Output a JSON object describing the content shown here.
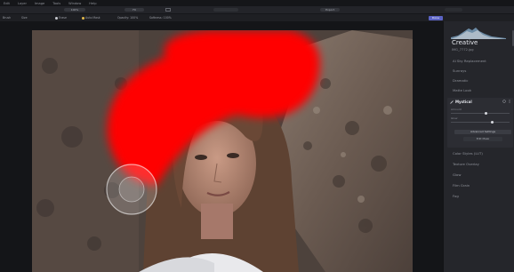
{
  "menubar": {
    "items": [
      "Edit",
      "Layer",
      "Image",
      "Tools",
      "Window",
      "Help"
    ]
  },
  "toolbar": {
    "zoom_label": "100%",
    "center_label": "Fit",
    "right_label": "Export"
  },
  "options": {
    "mode_label": "Brush",
    "size_label": "Size",
    "erase_label": "Erase",
    "auto_label": "Auto Mask",
    "opacity_label": "Opacity: 100%",
    "softness_label": "Softness: 100%",
    "done_label": "Done"
  },
  "panel": {
    "title": "Creative",
    "filename": "IMG_7772.jpg",
    "tools": [
      "AI Sky Replacement",
      "Sunrays",
      "Dramatic",
      "Matte Look"
    ],
    "filter": {
      "name": "Mystical",
      "sliders": [
        {
          "label": "Amount",
          "value": 0.6
        },
        {
          "label": "Glow",
          "value": 0.7
        }
      ],
      "advanced_label": "Advanced Settings",
      "edit_mask_label": "Edit Mask"
    },
    "tools_after": [
      "Color Styles (LUT)",
      "Texture Overlay",
      "Glow",
      "Film Grain",
      "Fog"
    ]
  },
  "colors": {
    "mask": "#ff0000",
    "accent": "#5b63c4"
  }
}
